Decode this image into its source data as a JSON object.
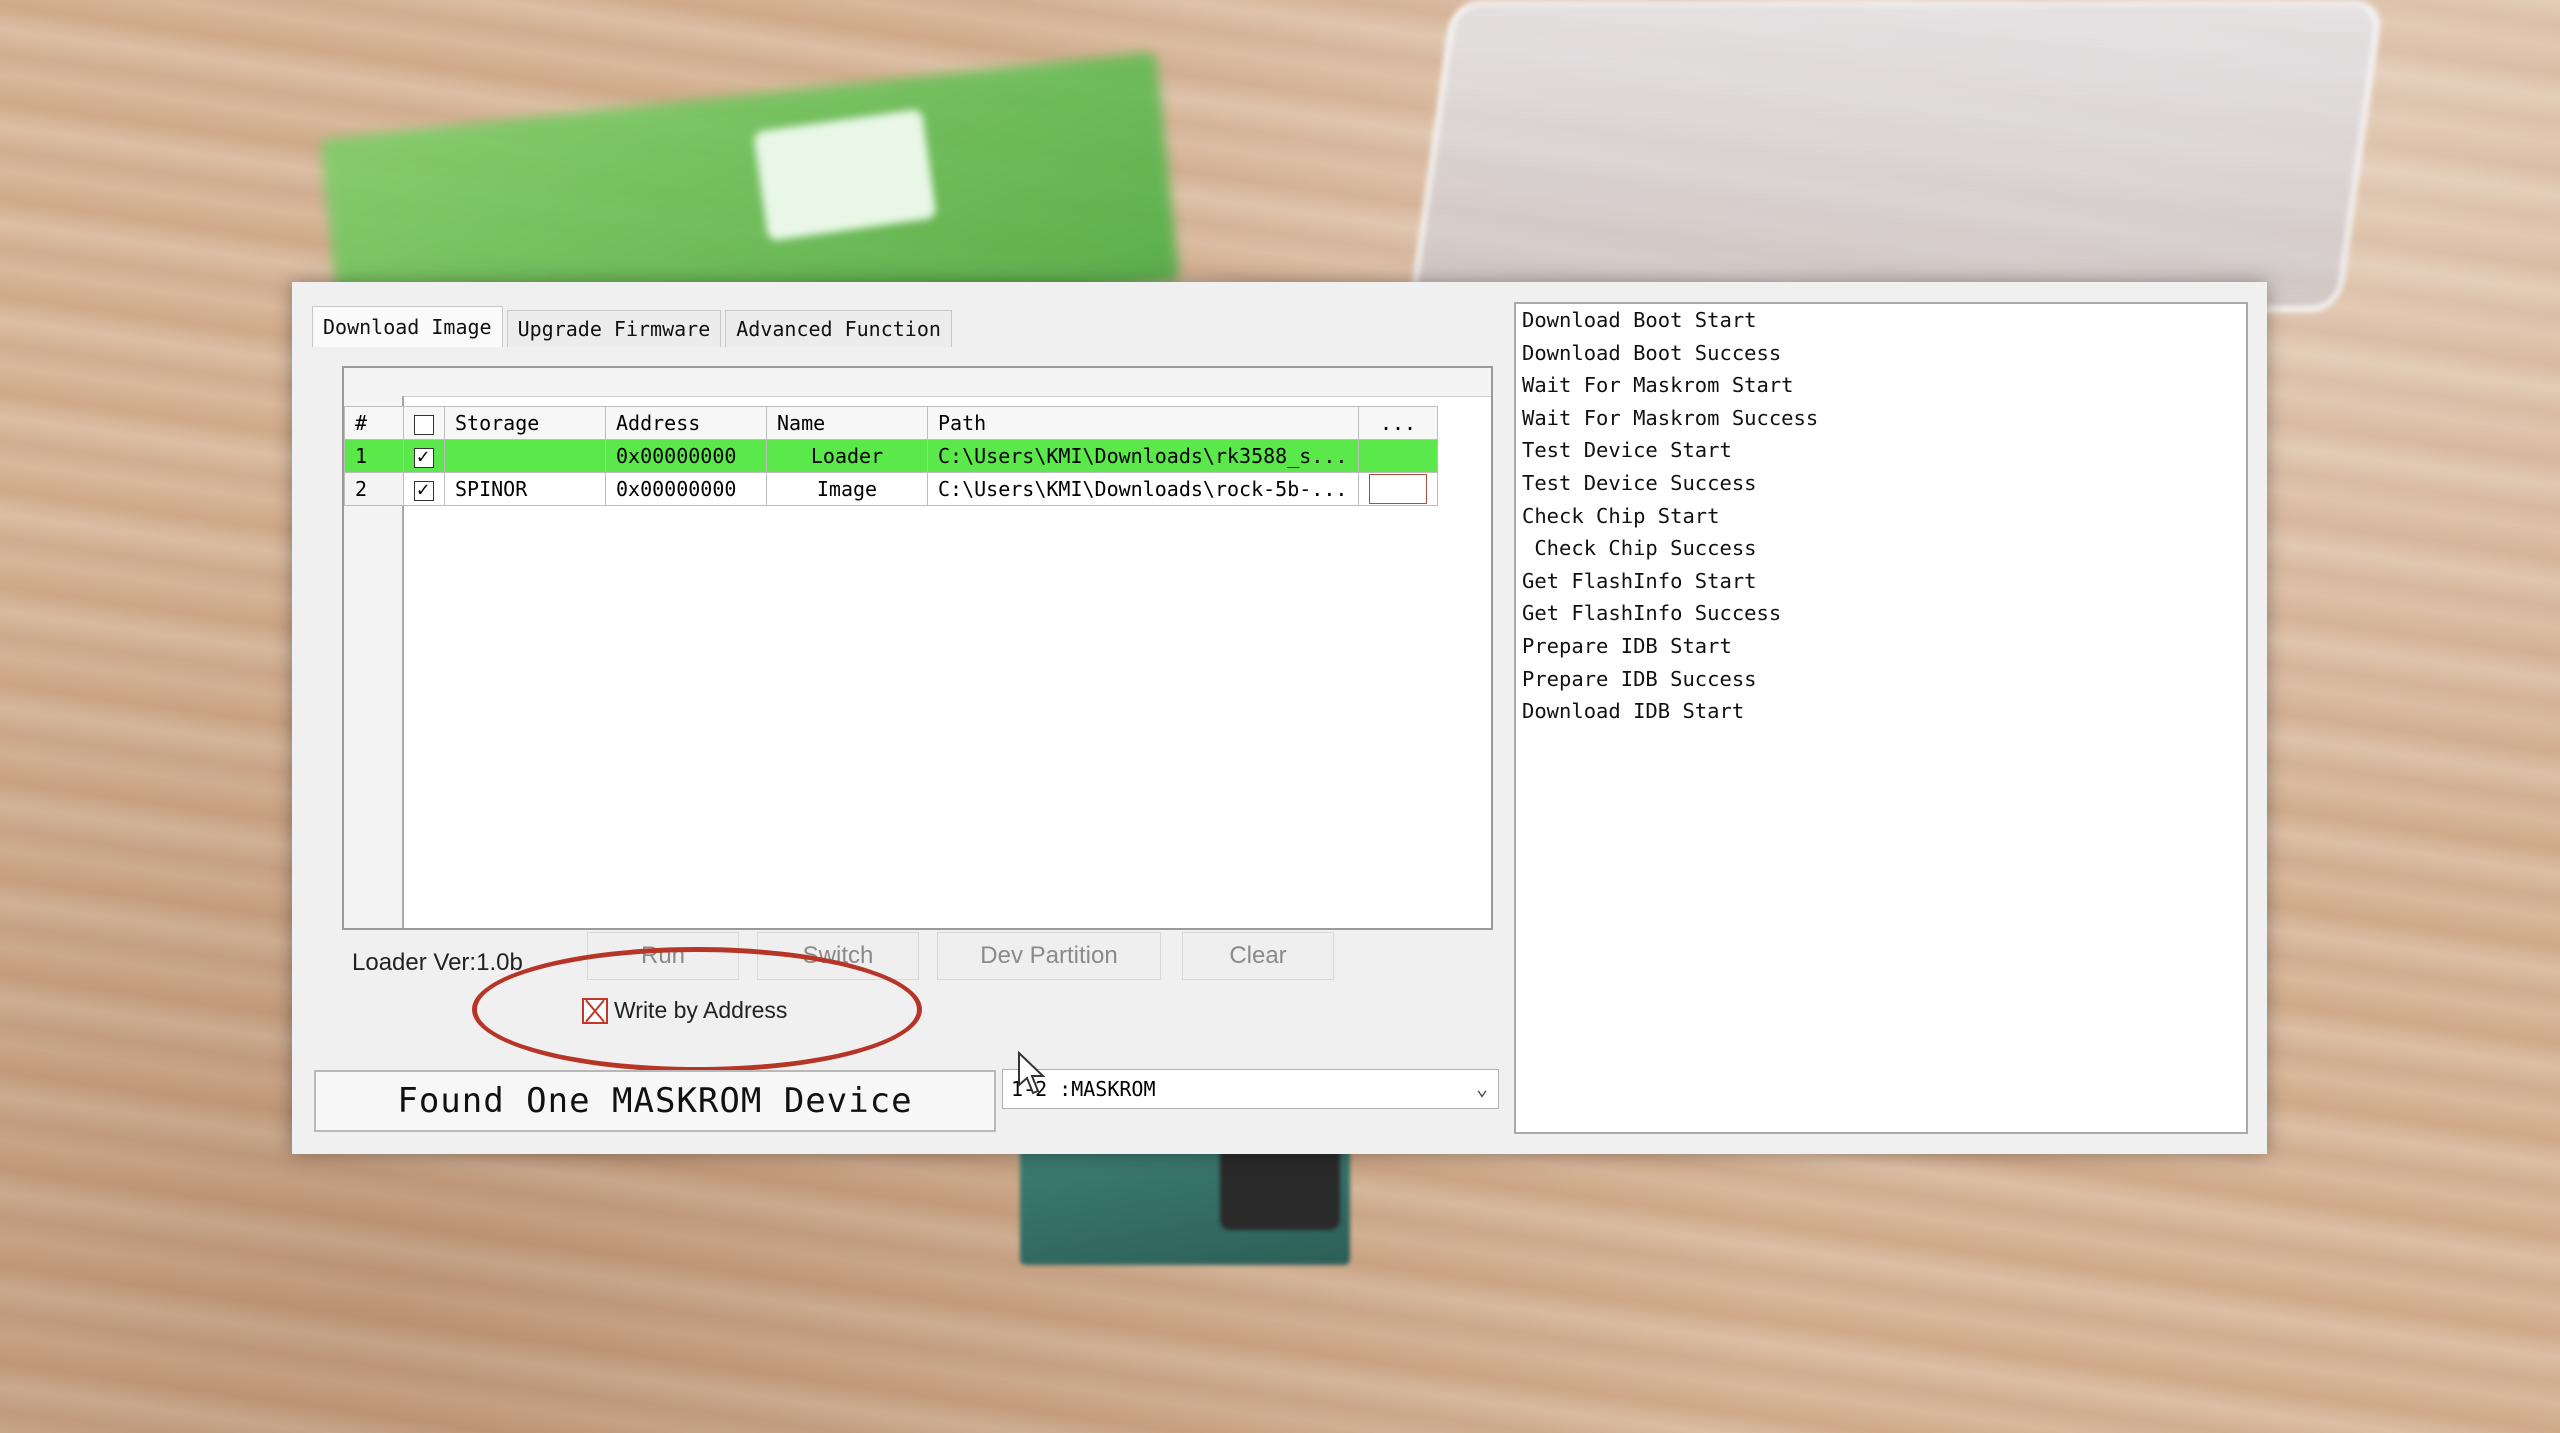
{
  "tabs": [
    "Download Image",
    "Upgrade Firmware",
    "Advanced Function"
  ],
  "grid": {
    "headers": {
      "num": "#",
      "storage": "Storage",
      "address": "Address",
      "name": "Name",
      "path": "Path",
      "more": "..."
    },
    "rows": [
      {
        "num": "1",
        "checked": true,
        "storage": "",
        "address": "0x00000000",
        "name": "Loader",
        "path": "C:\\Users\\KMI\\Downloads\\rk3588_s..."
      },
      {
        "num": "2",
        "checked": true,
        "storage": "SPINOR",
        "address": "0x00000000",
        "name": "Image",
        "path": "C:\\Users\\KMI\\Downloads\\rock-5b-..."
      }
    ]
  },
  "loader_version": "Loader Ver:1.0b",
  "buttons": {
    "run": "Run",
    "switch": "Switch",
    "dev_partition": "Dev Partition",
    "clear": "Clear"
  },
  "write_by_address": {
    "label": "Write by Address",
    "checked": true
  },
  "status": "Found One MASKROM Device",
  "device_select": {
    "value": "1-2 :MASKROM"
  },
  "log": [
    "Download Boot Start",
    "Download Boot Success",
    "Wait For Maskrom Start",
    "Wait For Maskrom Success",
    "Test Device Start",
    "Test Device Success",
    "Check Chip Start",
    " Check Chip Success",
    "Get FlashInfo Start",
    "Get FlashInfo Success",
    "Prepare IDB Start",
    "Prepare IDB Success",
    "Download IDB Start"
  ],
  "colors": {
    "selected_row": "#5be84a",
    "annotation": "#b73526"
  }
}
